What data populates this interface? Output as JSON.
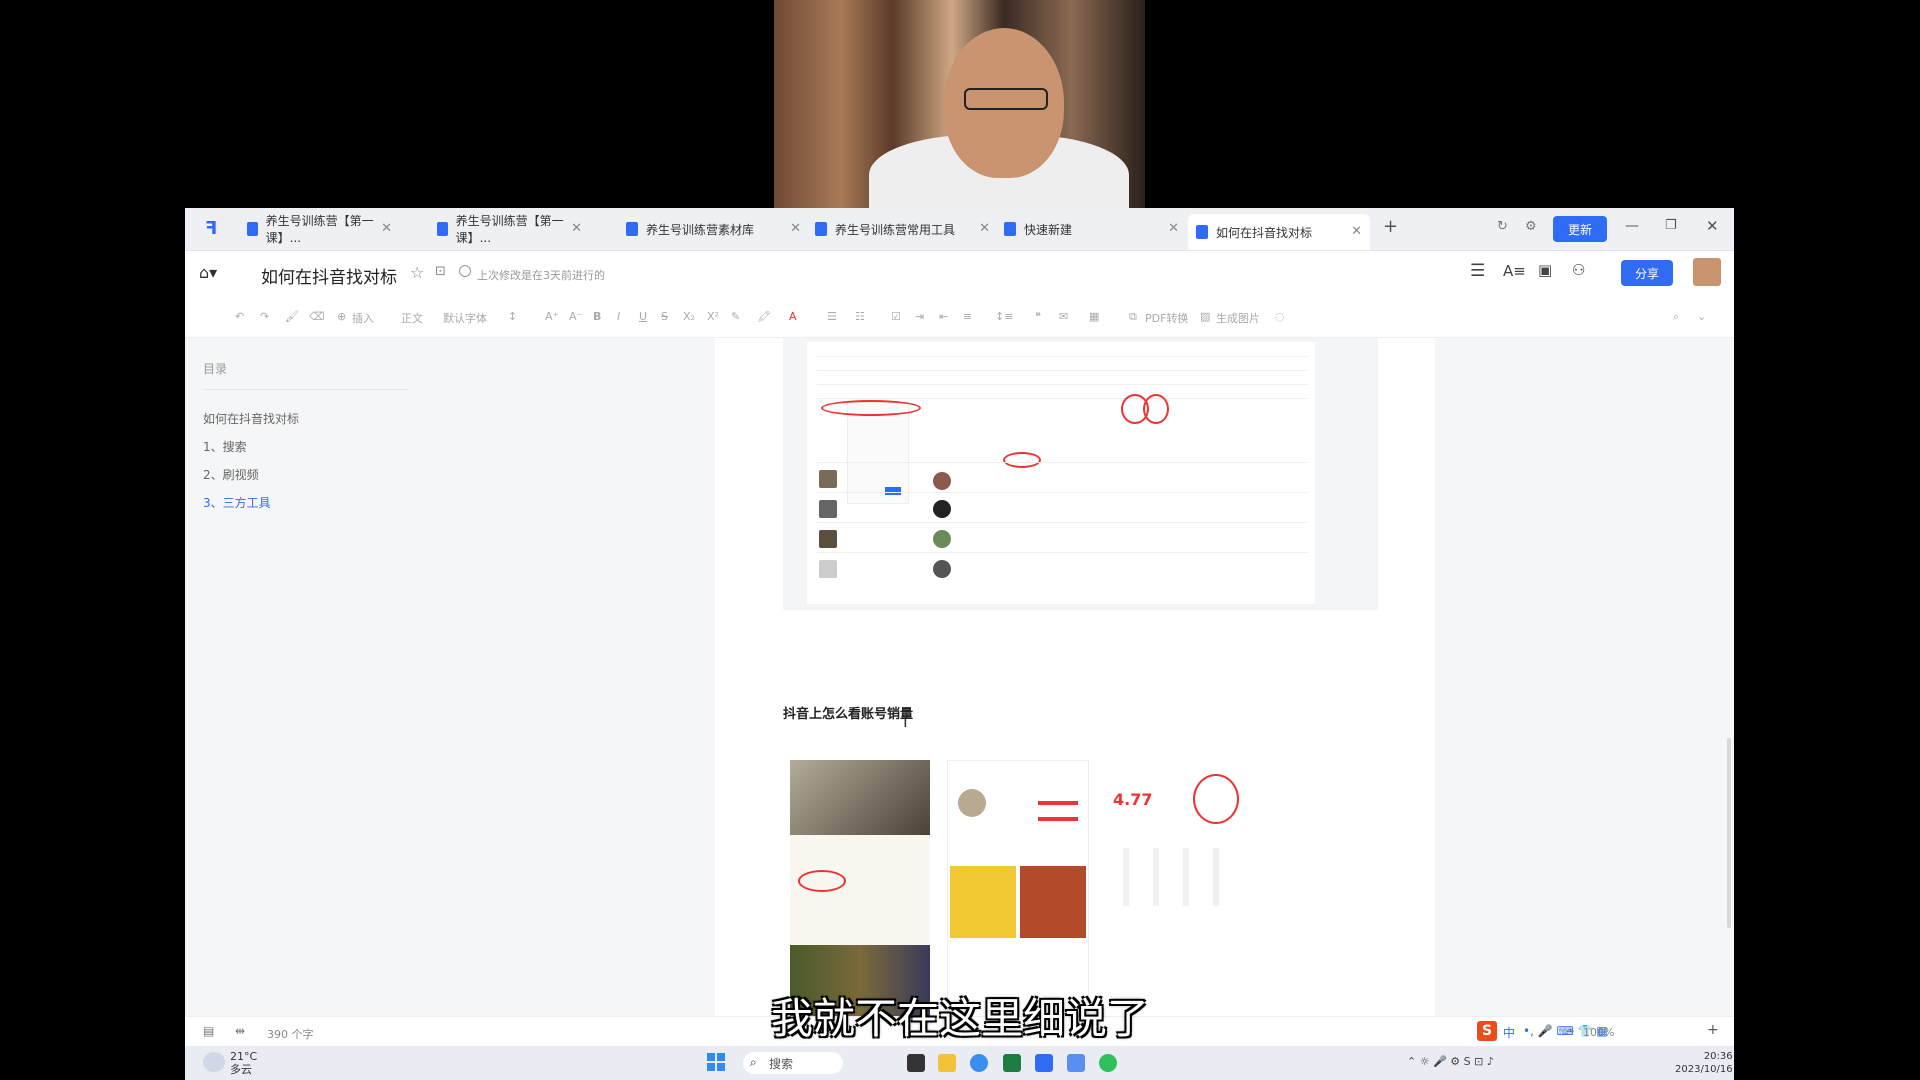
{
  "tabs": [
    {
      "label": "养生号训练营【第一课】..."
    },
    {
      "label": "养生号训练营【第一课】..."
    },
    {
      "label": "养生号训练营素材库"
    },
    {
      "label": "养生号训练营常用工具"
    },
    {
      "label": "快速新建"
    },
    {
      "label": "如何在抖音找对标"
    }
  ],
  "window": {
    "update_label": "更新",
    "new_tab_symbol": "+"
  },
  "doc": {
    "title": "如何在抖音找对标",
    "save_note": "上次修改是在3天前进行的",
    "share_label": "分享"
  },
  "format_bar": {
    "insert": "插入",
    "style": "正文",
    "font": "默认字体",
    "pdf": "PDF转换",
    "image": "生成图片"
  },
  "toc": {
    "heading": "目录",
    "items": [
      {
        "label": "如何在抖音找对标",
        "active": false
      },
      {
        "label": "1、搜索",
        "active": false
      },
      {
        "label": "2、刷视频",
        "active": false
      },
      {
        "label": "3、三方工具",
        "active": true
      }
    ]
  },
  "content": {
    "section_heading": "抖音上怎么看账号销量",
    "shot2c_score": "4.77"
  },
  "status": {
    "word_count": "390 个字",
    "zoom": "100%"
  },
  "taskbar": {
    "temperature": "21°C",
    "condition": "多云",
    "search_label": "搜索",
    "time": "20:36",
    "date": "2023/10/16",
    "ime_label": "中"
  },
  "subtitle": "我就不在这里细说了",
  "colors": {
    "accent": "#2f6bf5",
    "highlight_ring": "#e33333"
  }
}
